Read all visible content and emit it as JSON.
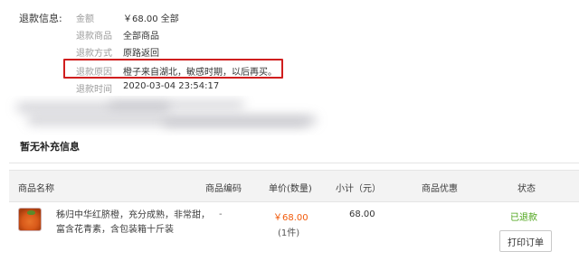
{
  "refund": {
    "title": "退款信息:",
    "amount_label": "金额",
    "amount_value": "￥68.00 全部",
    "goods_label": "退款商品",
    "goods_value": "全部商品",
    "method_label": "退款方式",
    "method_value": "原路返回",
    "reason_label": "退款原因",
    "reason_value": "橙子来自湖北，敏感时期，以后再买。",
    "time_label": "退款时间",
    "time_value": "2020-03-04 23:54:17"
  },
  "no_extra_info": "暂无补充信息",
  "table": {
    "headers": [
      "商品名称",
      "商品编码",
      "单价(数量)",
      "小计（元）",
      "商品优惠",
      "状态"
    ]
  },
  "item": {
    "name": "秭归中华红脐橙，充分成熟，非常甜，富含花青素，含包装箱十斤装",
    "code": "-",
    "price": "￥68.00",
    "qty": "(1件)",
    "subtotal": "68.00",
    "status": "已退款",
    "print_label": "打印订单"
  },
  "colors": {
    "highlight": "#d01e1e",
    "price": "#f25a0a",
    "status": "#4aa316"
  },
  "icons": [
    "orange-product-thumbnail-icon"
  ]
}
